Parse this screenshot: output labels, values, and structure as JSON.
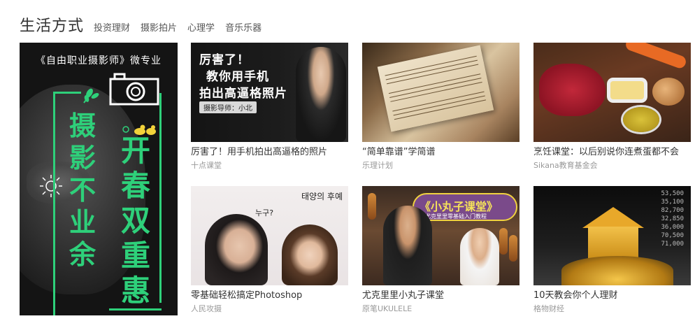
{
  "header": {
    "title": "生活方式",
    "tabs": [
      "投资理财",
      "摄影拍片",
      "心理学",
      "音乐乐器"
    ]
  },
  "promo": {
    "subtitle": "《自由职业摄影师》微专业",
    "vertical_left": "摄影不业余",
    "vertical_right": "开春双重惠",
    "accent_color": "#2ed07a",
    "icons": [
      "camera-icon",
      "leaf-icon",
      "duck-icon",
      "sun-icon"
    ]
  },
  "courses": [
    {
      "name": "厉害了！用手机拍出高逼格的照片",
      "org": "十点课堂",
      "thumb_text": [
        "厉害了！",
        "教你用手机",
        "拍出高逼格照片"
      ],
      "thumb_badge": "摄影导师：小北"
    },
    {
      "name": "“简单靠谱”学简谱",
      "org": "乐理计划"
    },
    {
      "name": "烹饪课堂：以后别说你连煮蛋都不会",
      "org": "Sikana教育基金会"
    },
    {
      "name": "零基础轻松搞定Photoshop",
      "org": "人民攻摄",
      "thumb_text": [
        "태양의 후예",
        "누구?"
      ]
    },
    {
      "name": "尤克里里小丸子课堂",
      "org": "原笔UKULELE",
      "thumb_text": [
        "《小丸子课堂》",
        "尤克里里零基础入门教程"
      ]
    },
    {
      "name": "10天教会你个人理财",
      "org": "格物财经",
      "thumb_numbers": [
        "53,500",
        "35,100",
        "82,700",
        "32,850",
        "36,000",
        "70,500",
        "71,000"
      ]
    }
  ]
}
